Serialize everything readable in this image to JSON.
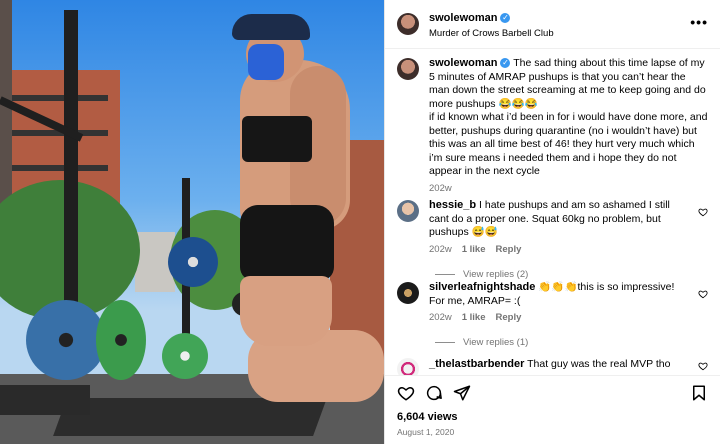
{
  "header": {
    "username": "swolewoman",
    "subtitle": "Murder of Crows Barbell Club",
    "more_label": "•••"
  },
  "caption": {
    "username": "swolewoman",
    "text": "The sad thing about this time lapse of my 5 minutes of AMRAP pushups is that you can’t hear the man down the street screaming at me to keep going and do more pushups 😂😂😂",
    "text2": "if id known what i’d been in for i would have done more, and better, pushups during quarantine (no i wouldn’t have) but this was an all time best of 46! they hurt very much which i’m sure means i needed them and i hope they do not appear in the next cycle",
    "time": "202w"
  },
  "comments": [
    {
      "username": "hessie_b",
      "text": "I hate pushups and am so ashamed I still cant do a proper one. Squat 60kg no problem, but pushups 😅😅",
      "time": "202w",
      "likes": "1 like",
      "reply": "Reply",
      "view_replies": "View replies (2)"
    },
    {
      "username": "silverleafnightshade",
      "text": "👏👏👏this is so impressive! For me, AMRAP= :(",
      "time": "202w",
      "likes": "1 like",
      "reply": "Reply",
      "view_replies": "View replies (1)"
    },
    {
      "username": "_thelastbarbender",
      "text": "That guy was the real MVP tho"
    }
  ],
  "footer": {
    "views": "6,604 views",
    "date": "August 1, 2020"
  },
  "colors": {
    "verified": "#3897f0",
    "muted": "#737373"
  },
  "icons": [
    "heart-icon",
    "comment-icon",
    "share-icon",
    "bookmark-icon",
    "more-icon",
    "verified-badge-icon"
  ]
}
